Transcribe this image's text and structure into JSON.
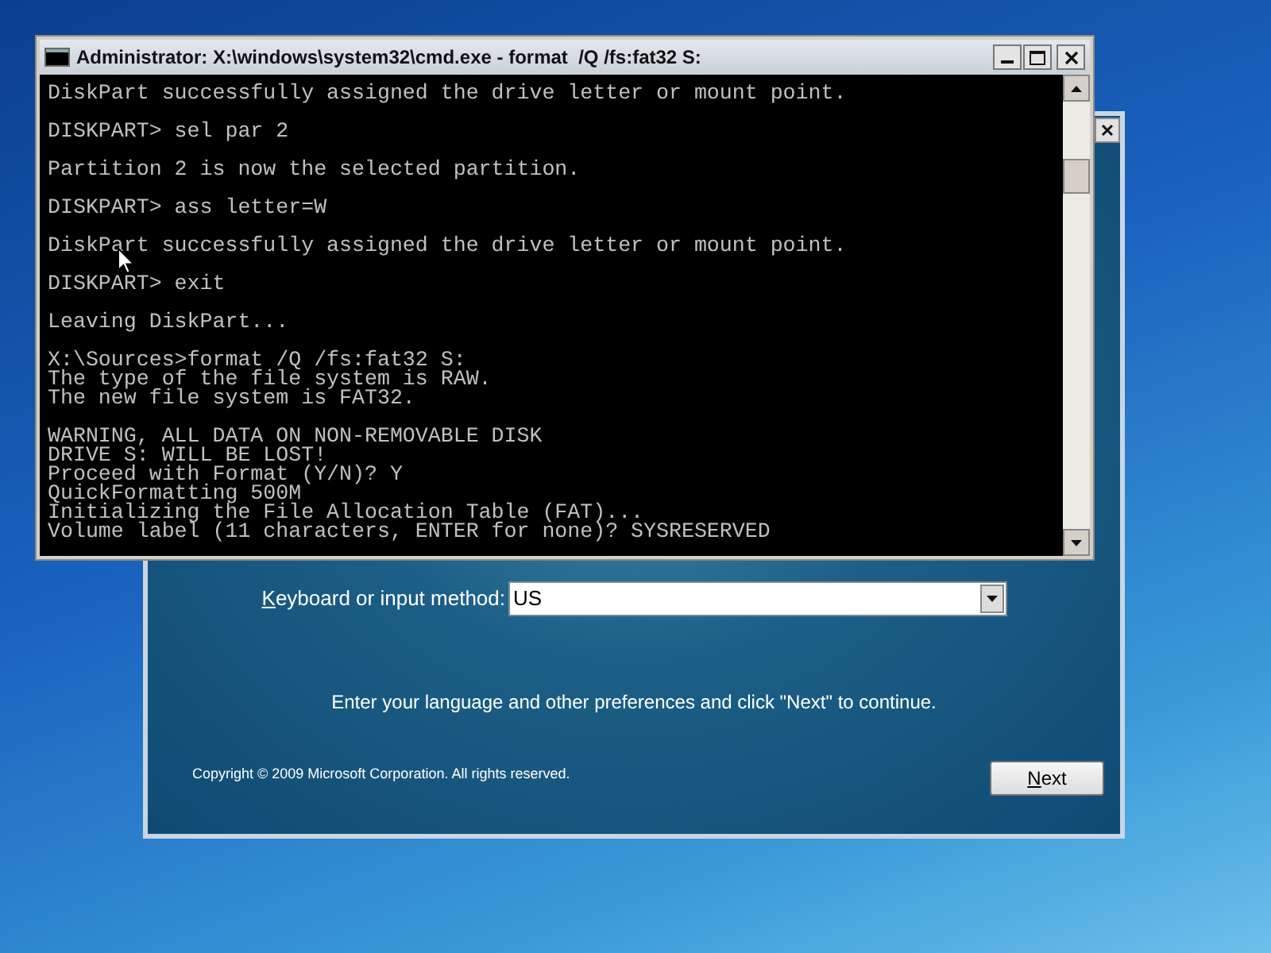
{
  "setup_window": {
    "keyboard": {
      "label": "Keyboard or input method:",
      "value": "US"
    },
    "instruction": "Enter your language and other preferences and click \"Next\" to continue.",
    "copyright": "Copyright © 2009 Microsoft Corporation. All rights reserved.",
    "next_button": "Next"
  },
  "cmd_window": {
    "title": "Administrator: X:\\windows\\system32\\cmd.exe - format  /Q /fs:fat32 S:",
    "blocks": [
      [
        "DiskPart successfully assigned the drive letter or mount point."
      ],
      [
        "DISKPART> sel par 2"
      ],
      [
        "Partition 2 is now the selected partition."
      ],
      [
        "DISKPART> ass letter=W"
      ],
      [
        "DiskPart successfully assigned the drive letter or mount point."
      ],
      [
        "DISKPART> exit"
      ],
      [
        "Leaving DiskPart..."
      ],
      [
        "X:\\Sources>format /Q /fs:fat32 S:",
        "The type of the file system is RAW.",
        "The new file system is FAT32."
      ],
      [
        "WARNING, ALL DATA ON NON-REMOVABLE DISK",
        "DRIVE S: WILL BE LOST!",
        "Proceed with Format (Y/N)? Y",
        "QuickFormatting 500M",
        "Initializing the File Allocation Table (FAT)...",
        "Volume label (11 characters, ENTER for none)? SYSRESERVED"
      ]
    ]
  }
}
